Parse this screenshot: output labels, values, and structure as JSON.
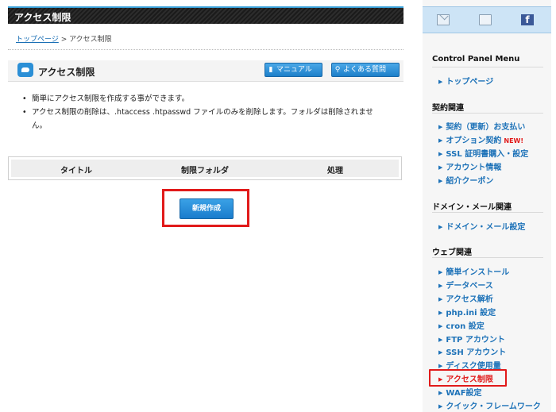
{
  "page_title": "アクセス制限",
  "breadcrumb": {
    "home": "トップページ",
    "sep": ">",
    "current": "アクセス制限"
  },
  "section": {
    "title": "アクセス制限",
    "manual_label": "マニュアル",
    "faq_label": "よくある質問"
  },
  "bullets": [
    "簡単にアクセス制限を作成する事ができます。",
    "アクセス制限の削除は、.htaccess .htpasswd ファイルのみを削除します。フォルダは削除されません。"
  ],
  "table": {
    "headers": [
      "タイトル",
      "制限フォルダ",
      "処理"
    ]
  },
  "create_button": "新規作成",
  "sidebar": {
    "menu_title": "Control Panel Menu",
    "top_item": "トップページ",
    "groups": [
      {
        "title": "契約関連",
        "items": [
          "契約（更新）お支払い",
          "オプション契約",
          "SSL 証明書購入・設定",
          "アカウント情報",
          "紹介クーポン"
        ],
        "new_badge": "NEW!"
      },
      {
        "title": "ドメイン・メール関連",
        "items": [
          "ドメイン・メール設定"
        ]
      },
      {
        "title": "ウェブ関連",
        "items": [
          "簡単インストール",
          "データベース",
          "アクセス解析",
          "php.ini 設定",
          "cron 設定",
          "FTP アカウント",
          "SSH アカウント",
          "ディスク使用量",
          "アクセス制限",
          "WAF設定",
          "クイック・フレームワーク"
        ]
      }
    ],
    "icons": [
      "mail-icon",
      "folder-icon",
      "facebook-icon"
    ]
  },
  "colors": {
    "accent": "#1d72b8",
    "highlight": "#e11a1a",
    "title_bar": "#1b1b1b"
  }
}
